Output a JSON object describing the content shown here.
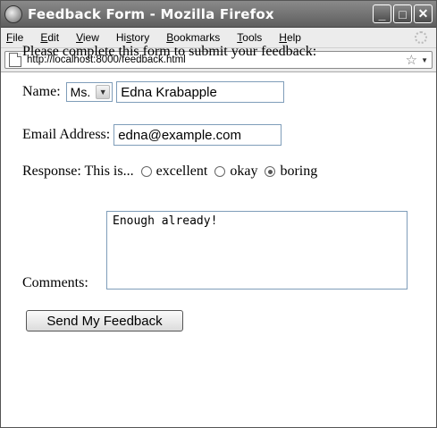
{
  "window": {
    "title": "Feedback Form - Mozilla Firefox",
    "buttons": {
      "minimize": "_",
      "maximize": "□",
      "close": "✕"
    }
  },
  "menubar": {
    "items": [
      {
        "label": "File",
        "mnemonic": "F",
        "rest": "ile"
      },
      {
        "label": "Edit",
        "mnemonic": "E",
        "rest": "dit"
      },
      {
        "label": "View",
        "mnemonic": "V",
        "rest": "iew"
      },
      {
        "label": "History",
        "mnemonic": "s",
        "pre": "Hi",
        "rest": "tory"
      },
      {
        "label": "Bookmarks",
        "mnemonic": "B",
        "rest": "ookmarks"
      },
      {
        "label": "Tools",
        "mnemonic": "T",
        "rest": "ools"
      },
      {
        "label": "Help",
        "mnemonic": "H",
        "rest": "elp"
      }
    ]
  },
  "navbar": {
    "url": "http://localhost:8000/feedback.html",
    "star_icon": "☆",
    "dropmarker_icon": "▼"
  },
  "form": {
    "intro": "Please complete this form to submit your feedback:",
    "name_label": "Name:",
    "title_select_value": "Ms.",
    "select_arrow_icon": "▼",
    "name_value": "Edna Krabapple",
    "email_label": "Email Address:",
    "email_value": "edna@example.com",
    "response_label": "Response: This is...",
    "response_options": [
      "excellent",
      "okay",
      "boring"
    ],
    "response_selected": "boring",
    "comments_label": "Comments:",
    "comments_value": "Enough already!",
    "submit_label": "Send My Feedback"
  }
}
